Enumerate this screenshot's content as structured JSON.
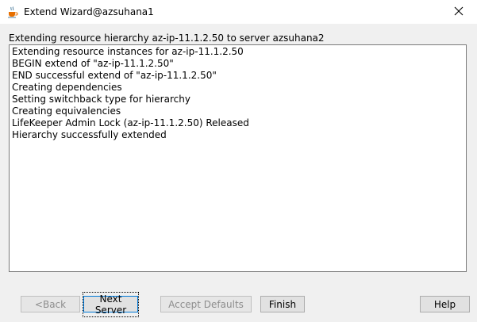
{
  "window": {
    "title": "Extend Wizard@azsuhana1",
    "icon": "java-cup-icon",
    "close_glyph": "✕"
  },
  "heading": "Extending resource hierarchy az-ip-11.1.2.50 to server azsuhana2",
  "log": {
    "lines": [
      "Extending resource instances for az-ip-11.1.2.50",
      "BEGIN extend of \"az-ip-11.1.2.50\"",
      "END successful extend of \"az-ip-11.1.2.50\"",
      "Creating dependencies",
      "Setting switchback type for hierarchy",
      "Creating equivalencies",
      "LifeKeeper Admin Lock (az-ip-11.1.2.50) Released",
      "Hierarchy successfully extended"
    ]
  },
  "buttons": {
    "back": "<Back",
    "next_server": "Next Server",
    "accept_defaults": "Accept Defaults",
    "finish": "Finish",
    "help": "Help"
  },
  "colors": {
    "window_bg": "#f0f0f0",
    "titlebar_bg": "#ffffff",
    "focus_border": "#0078d7",
    "disabled_text": "#8d8d8d"
  }
}
